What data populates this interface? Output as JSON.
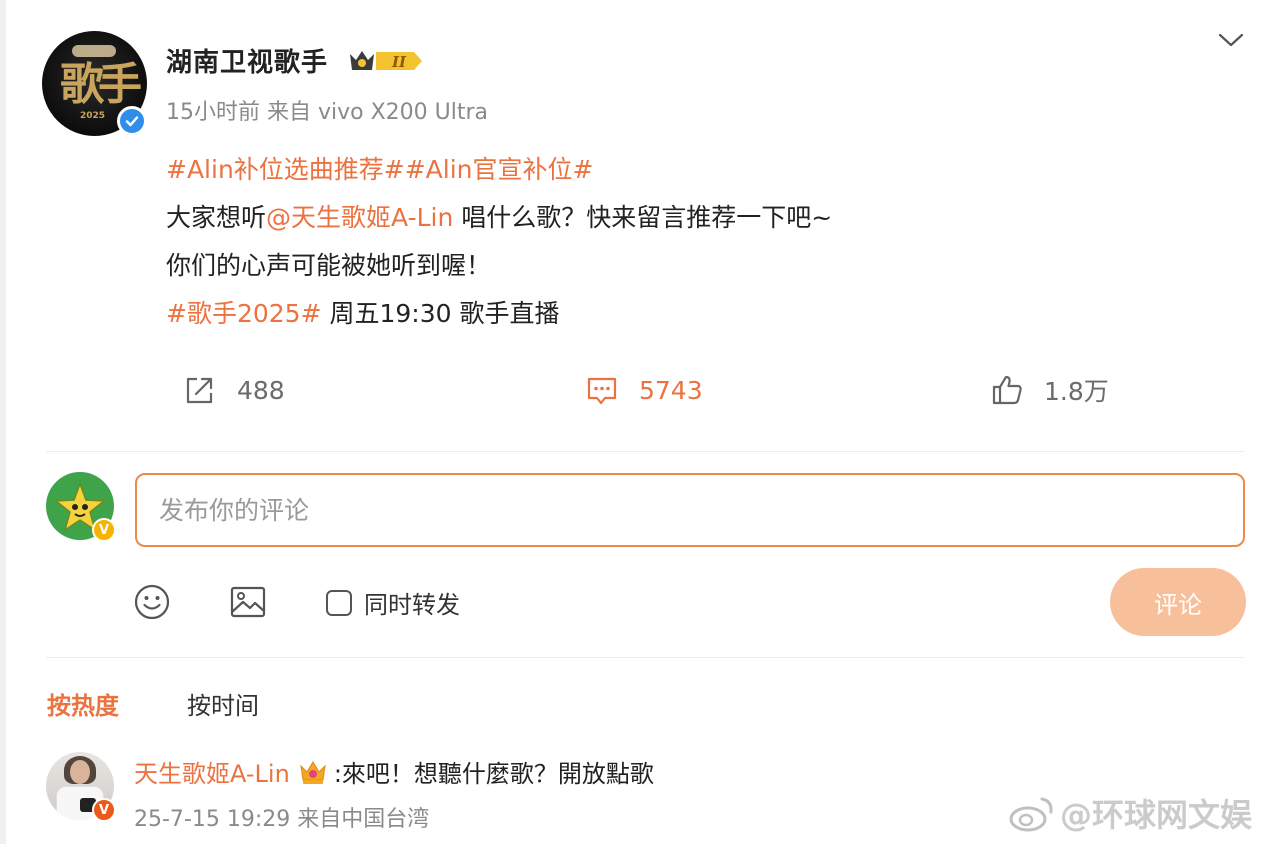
{
  "post": {
    "author": "湖南卫视歌手",
    "level": "II",
    "time": "15小时前",
    "source": "来自 vivo X200 Ultra",
    "lines": [
      [
        "#Alin补位选曲推荐##Alin官宣补位#",
        ""
      ],
      [
        "大家想听",
        "@天生歌姬A-Lin",
        " 唱什么歌？快来留言推荐一下吧~"
      ],
      [
        "你们的心声可能被她听到喔！"
      ],
      [
        "#歌手2025#",
        " 周五19:30 歌手直播"
      ]
    ],
    "avatar_text": "歌手",
    "avatar_year": "2025"
  },
  "actions": {
    "repost_count": "488",
    "comment_count": "5743",
    "like_count": "1.8万"
  },
  "compose": {
    "placeholder": "发布你的评论",
    "repost_label": "同时转发",
    "submit_label": "评论",
    "badge": "V"
  },
  "sort": {
    "hot": "按热度",
    "time": "按时间"
  },
  "comment": {
    "author": "天生歌姬A-Lin",
    "text": ":來吧！想聽什麼歌？開放點歌",
    "time": "25-7-15 19:29",
    "source": "来自中国台湾",
    "badge": "V"
  },
  "watermark": "@环球网文娱",
  "colors": {
    "accent": "#eb7340",
    "verify_blue": "#2f8fe8",
    "submit_disabled": "#f7c09b"
  },
  "icons": [
    "verified-icon",
    "crown-level-icon",
    "chevron-down-icon",
    "repost-icon",
    "comment-icon",
    "like-icon",
    "emoji-icon",
    "image-icon",
    "crown-icon",
    "weibo-logo-icon"
  ]
}
